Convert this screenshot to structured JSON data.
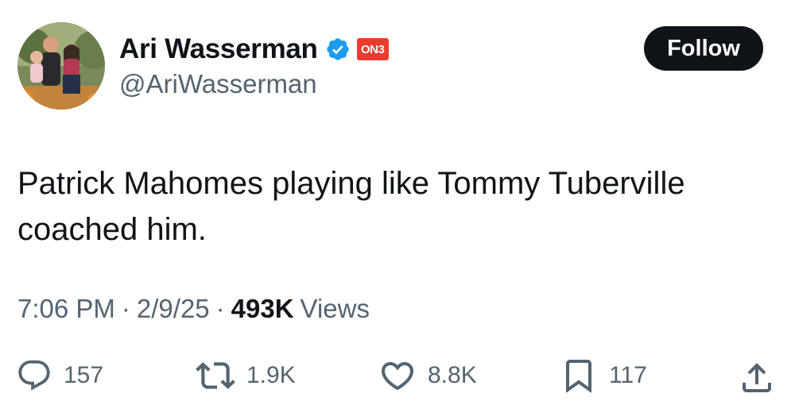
{
  "author": {
    "name": "Ari Wasserman",
    "handle": "@AriWasserman",
    "affiliation_badge": "ON3",
    "verified": true,
    "badge_color": "#ea3d2f",
    "verified_color": "#1d9bf0"
  },
  "follow_label": "Follow",
  "tweet": {
    "text_line1": "Patrick Mahomes playing like Tommy Tuberville",
    "text_line2": "coached him."
  },
  "meta": {
    "time": "7:06 PM",
    "date": "2/9/25",
    "views_count": "493K",
    "views_label": "Views",
    "separator": "·"
  },
  "actions": {
    "replies": "157",
    "reposts": "1.9K",
    "likes": "8.8K",
    "bookmarks": "117"
  },
  "icons": [
    "comment-icon",
    "repost-icon",
    "like-icon",
    "bookmark-icon",
    "share-icon",
    "verified-icon"
  ]
}
